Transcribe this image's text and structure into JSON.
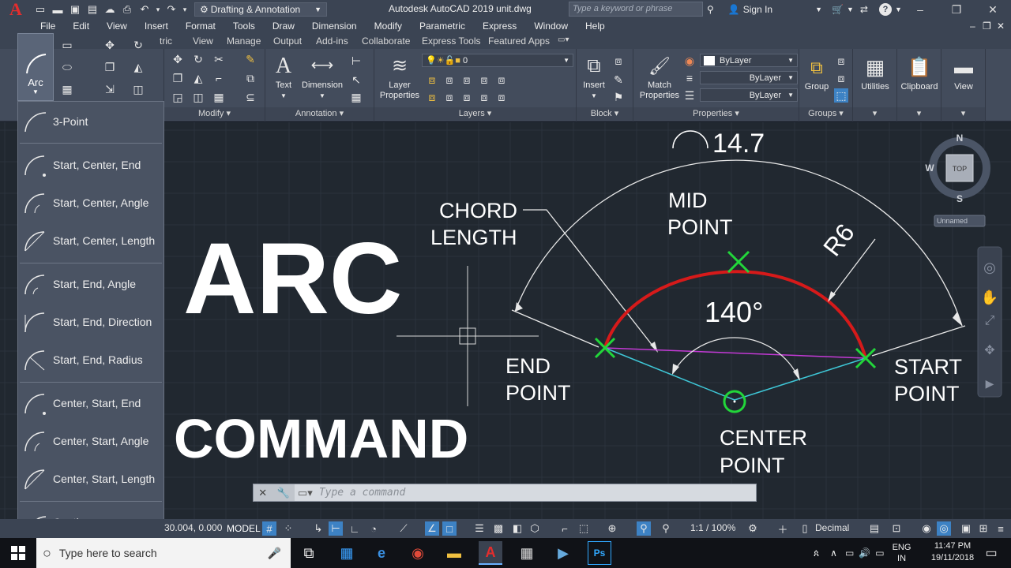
{
  "titlebar": {
    "app_letter": "A",
    "workspace": "Drafting & Annotation",
    "title": "Autodesk AutoCAD 2019   unit.dwg",
    "search_placeholder": "Type a keyword or phrase",
    "sign_in": "Sign In"
  },
  "menu": [
    "File",
    "Edit",
    "View",
    "Insert",
    "Format",
    "Tools",
    "Draw",
    "Dimension",
    "Modify",
    "Parametric",
    "Express",
    "Window",
    "Help"
  ],
  "ribbon_tabs": [
    "tric",
    "View",
    "Manage",
    "Output",
    "Add-ins",
    "Collaborate",
    "Express Tools",
    "Featured Apps"
  ],
  "ribbon": {
    "arc_label": "Arc",
    "modify_title": "Modify",
    "annotation_title": "Annotation",
    "text_label": "Text",
    "dimension_label": "Dimension",
    "layers_title": "Layers",
    "layer_properties_label": "Layer Properties",
    "layer_value": "0",
    "block_title": "Block",
    "insert_label": "Insert",
    "properties_title": "Properties",
    "match_properties_label": "Match Properties",
    "bylayer_1": "ByLayer",
    "bylayer_2": "ByLayer",
    "bylayer_3": "ByLayer",
    "groups_title": "Groups",
    "group_label": "Group",
    "utilities_label": "Utilities",
    "clipboard_label": "Clipboard",
    "view_label": "View"
  },
  "arc_menu": [
    "3-Point",
    "Start, Center, End",
    "Start, Center, Angle",
    "Start, Center, Length",
    "Start, End, Angle",
    "Start, End, Direction",
    "Start, End, Radius",
    "Center, Start, End",
    "Center, Start, Angle",
    "Center, Start, Length",
    "Continue"
  ],
  "drawing": {
    "title_big": "ARC",
    "title_sub": "COMMAND",
    "arc_length": "14.7",
    "mid_point_1": "MID",
    "mid_point_2": "POINT",
    "radius": "R6",
    "chord_1": "CHORD",
    "chord_2": "LENGTH",
    "angle": "140°",
    "end_point_1": "END",
    "end_point_2": "POINT",
    "start_point_1": "START",
    "start_point_2": "POINT",
    "center_point_1": "CENTER",
    "center_point_2": "POINT",
    "colors": {
      "arc": "#d61a1a",
      "marker": "#22d63a",
      "chord": "#c43ad6",
      "radius_lines": "#3ec6d6",
      "dims": "#e8e8e8"
    }
  },
  "viewcube": {
    "n": "N",
    "s": "S",
    "w": "W",
    "face": "TOP",
    "ucs": "Unnamed"
  },
  "command_line": {
    "placeholder": "Type a command"
  },
  "status": {
    "coords": "30.004, 0.000",
    "model": "MODEL",
    "scale": "1:1 / 100%",
    "units": "Decimal"
  },
  "taskbar": {
    "search": "Type here to search",
    "lang_1": "ENG",
    "lang_2": "IN",
    "time": "11:47 PM",
    "date": "19/11/2018"
  }
}
